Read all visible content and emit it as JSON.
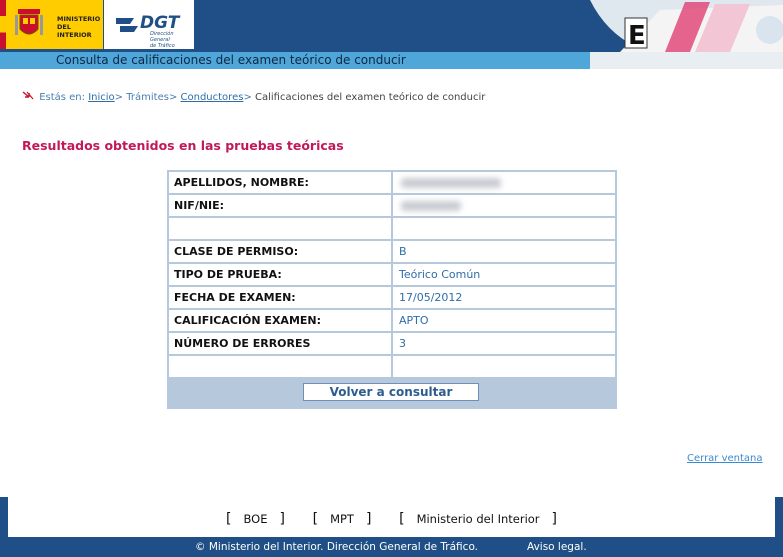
{
  "header": {
    "ministerio_line1": "MINISTERIO",
    "ministerio_line2": "DEL INTERIOR",
    "dgt_name": "DGT",
    "dgt_sub_line1": "Dirección General",
    "dgt_sub_line2": "de Tráfico",
    "page_title": "Consulta de calificaciones del examen teórico de conducir"
  },
  "breadcrumb": {
    "label": "Estás en:",
    "items": [
      "Inicio",
      "Trámites",
      "Conductores"
    ],
    "current": "Calificaciones del examen teórico de conducir",
    "separator": ">"
  },
  "heading": "Resultados obtenidos en las pruebas teóricas",
  "results": {
    "rows": [
      {
        "key": "APELLIDOS, NOMBRE:",
        "value": ""
      },
      {
        "key": "NIF/NIE:",
        "value": ""
      },
      {
        "key": "",
        "value": ""
      },
      {
        "key": "CLASE DE PERMISO:",
        "value": "B"
      },
      {
        "key": "TIPO DE PRUEBA:",
        "value": "Teórico Común"
      },
      {
        "key": "FECHA DE EXAMEN:",
        "value": "17/05/2012"
      },
      {
        "key": "CALIFICACIÓN EXAMEN:",
        "value": "APTO"
      },
      {
        "key": "NÚMERO DE ERRORES",
        "value": "3"
      },
      {
        "key": "",
        "value": ""
      }
    ],
    "back_button": "Volver a consultar"
  },
  "close_link": "Cerrar ventana",
  "footer": {
    "links": [
      "BOE",
      "MPT",
      "Ministerio del Interior"
    ],
    "copyright": "© Ministerio del Interior. Dirección General de Tráfico.",
    "legal": "Aviso legal."
  },
  "colors": {
    "brand_blue": "#1f4f86",
    "titlebar_blue": "#4ea6d9",
    "heading_magenta": "#c2185b",
    "link_blue": "#2f6da8"
  }
}
